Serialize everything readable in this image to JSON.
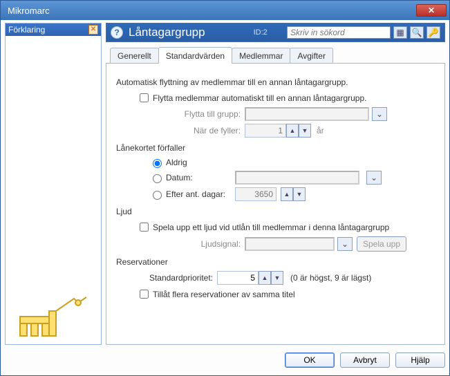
{
  "window": {
    "title": "Mikromarc"
  },
  "left_panel": {
    "title": "Förklaring"
  },
  "banner": {
    "title": "Låntagargrupp",
    "id_label": "ID:2",
    "search_placeholder": "Skriv in sökord"
  },
  "tabs": {
    "items": [
      {
        "label": "Generellt"
      },
      {
        "label": "Standardvärden"
      },
      {
        "label": "Medlemmar"
      },
      {
        "label": "Avgifter"
      }
    ],
    "active_index": 1
  },
  "auto_move": {
    "heading": "Automatisk flyttning av medlemmar till en annan låntagargrupp.",
    "checkbox_label": "Flytta medlemmar automatiskt till en annan låntagargrupp.",
    "group_label": "Flytta till grupp:",
    "group_value": "",
    "age_label": "När de fyller:",
    "age_value": "1",
    "age_unit": "år"
  },
  "card_expiry": {
    "heading": "Lånekortet förfaller",
    "options": {
      "never": "Aldrig",
      "date_label": "Datum:",
      "date_value": "",
      "after_days_label": "Efter ant. dagar:",
      "after_days_value": "3650"
    },
    "selected": "never"
  },
  "sound": {
    "heading": "Ljud",
    "checkbox_label": "Spela upp ett ljud vid utlån till medlemmar i denna låntagargrupp",
    "signal_label": "Ljudsignal:",
    "signal_value": "",
    "play_btn": "Spela upp"
  },
  "reservations": {
    "heading": "Reservationer",
    "priority_label": "Standardprioritet:",
    "priority_value": "5",
    "priority_note": "(0 är högst, 9 är lägst)",
    "allow_multi_label": "Tillåt flera reservationer av samma titel"
  },
  "buttons": {
    "ok": "OK",
    "cancel": "Avbryt",
    "help": "Hjälp"
  }
}
